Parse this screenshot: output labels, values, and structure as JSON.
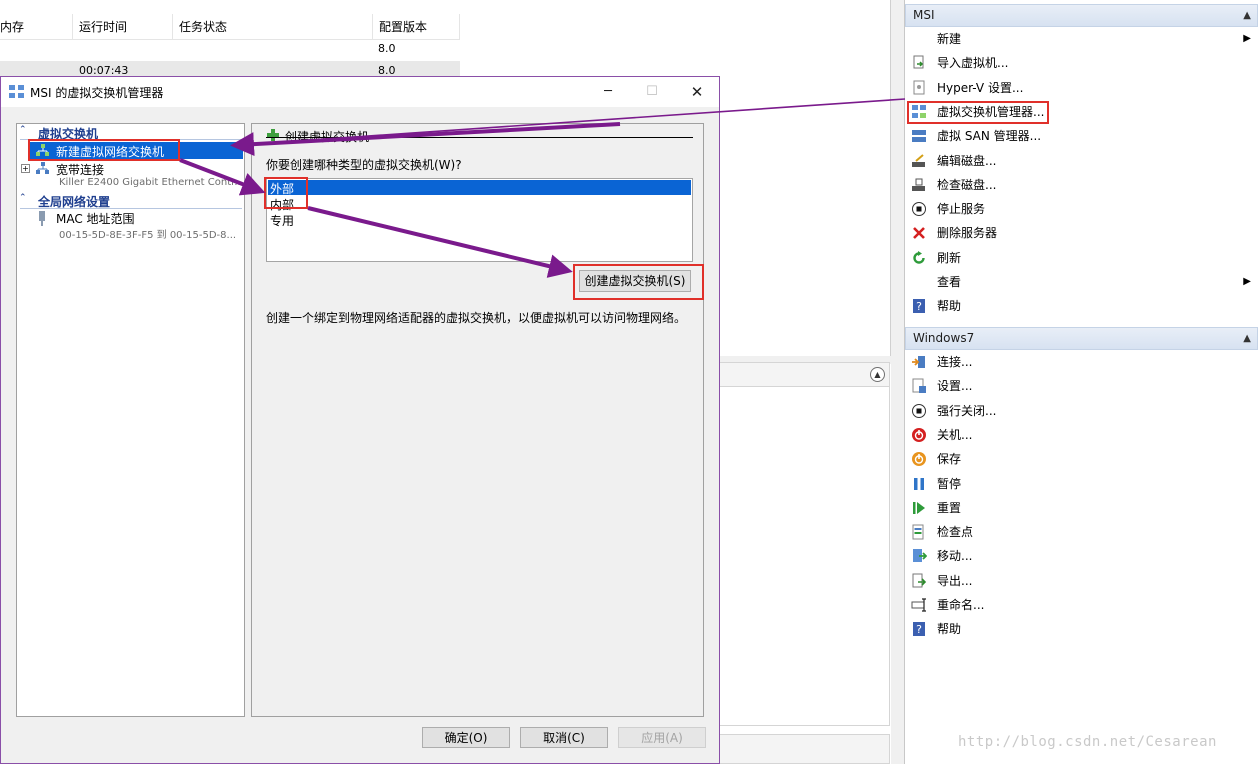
{
  "vm_list": {
    "columns": [
      "内存",
      "运行时间",
      "任务状态",
      "配置版本"
    ],
    "rows": [
      {
        "uptime": "",
        "config_version": "8.0"
      },
      {
        "uptime": "00:07:43",
        "config_version": "8.0"
      }
    ]
  },
  "actions": {
    "msi_header": "MSI",
    "msi_items": [
      {
        "label": "新建",
        "icon": "blank-icon",
        "submenu": true
      },
      {
        "label": "导入虚拟机...",
        "icon": "import-vm-icon"
      },
      {
        "label": "Hyper-V 设置...",
        "icon": "settings-page-icon"
      },
      {
        "label": "虚拟交换机管理器...",
        "icon": "switch-manager-icon"
      },
      {
        "label": "虚拟 SAN 管理器...",
        "icon": "san-manager-icon"
      },
      {
        "label": "编辑磁盘...",
        "icon": "edit-disk-icon"
      },
      {
        "label": "检查磁盘...",
        "icon": "inspect-disk-icon"
      },
      {
        "label": "停止服务",
        "icon": "stop-icon"
      },
      {
        "label": "删除服务器",
        "icon": "delete-icon"
      },
      {
        "label": "刷新",
        "icon": "refresh-icon"
      },
      {
        "label": "查看",
        "icon": "blank-icon",
        "submenu": true
      },
      {
        "label": "帮助",
        "icon": "help-icon"
      }
    ],
    "vm_header": "Windows7",
    "vm_items": [
      {
        "label": "连接...",
        "icon": "connect-icon"
      },
      {
        "label": "设置...",
        "icon": "vm-settings-icon"
      },
      {
        "label": "强行关闭...",
        "icon": "turn-off-icon"
      },
      {
        "label": "关机...",
        "icon": "shutdown-icon"
      },
      {
        "label": "保存",
        "icon": "save-icon"
      },
      {
        "label": "暂停",
        "icon": "pause-icon"
      },
      {
        "label": "重置",
        "icon": "reset-icon"
      },
      {
        "label": "检查点",
        "icon": "checkpoint-icon"
      },
      {
        "label": "移动...",
        "icon": "move-icon"
      },
      {
        "label": "导出...",
        "icon": "export-icon"
      },
      {
        "label": "重命名...",
        "icon": "rename-icon"
      },
      {
        "label": "帮助",
        "icon": "help-icon"
      }
    ]
  },
  "dialog": {
    "title": "MSI 的虚拟交换机管理器",
    "tree": {
      "section_switches": "虚拟交换机",
      "new_switch": "新建虚拟网络交换机",
      "broadband": "宽带连接",
      "broadband_adapter": "Killer E2400 Gigabit Ethernet Contr...",
      "section_global": "全局网络设置",
      "mac_range": "MAC 地址范围",
      "mac_range_value": "00-15-5D-8E-3F-F5 到 00-15-5D-8..."
    },
    "panel": {
      "header": "创建虚拟交换机",
      "question": "你要创建哪种类型的虚拟交换机(W)?",
      "options": [
        "外部",
        "内部",
        "专用"
      ],
      "selected_index": 0,
      "create_button": "创建虚拟交换机(S)",
      "description": "创建一个绑定到物理网络适配器的虚拟交换机，以便虚拟机可以访问物理网络。"
    },
    "buttons": {
      "ok": "确定(O)",
      "cancel": "取消(C)",
      "apply": "应用(A)"
    }
  },
  "watermark": "http://blog.csdn.net/Cesarean",
  "colors": {
    "annotation_arrow": "#7a1a8c",
    "annotation_box": "#e0302a",
    "selection": "#0a64d4"
  }
}
